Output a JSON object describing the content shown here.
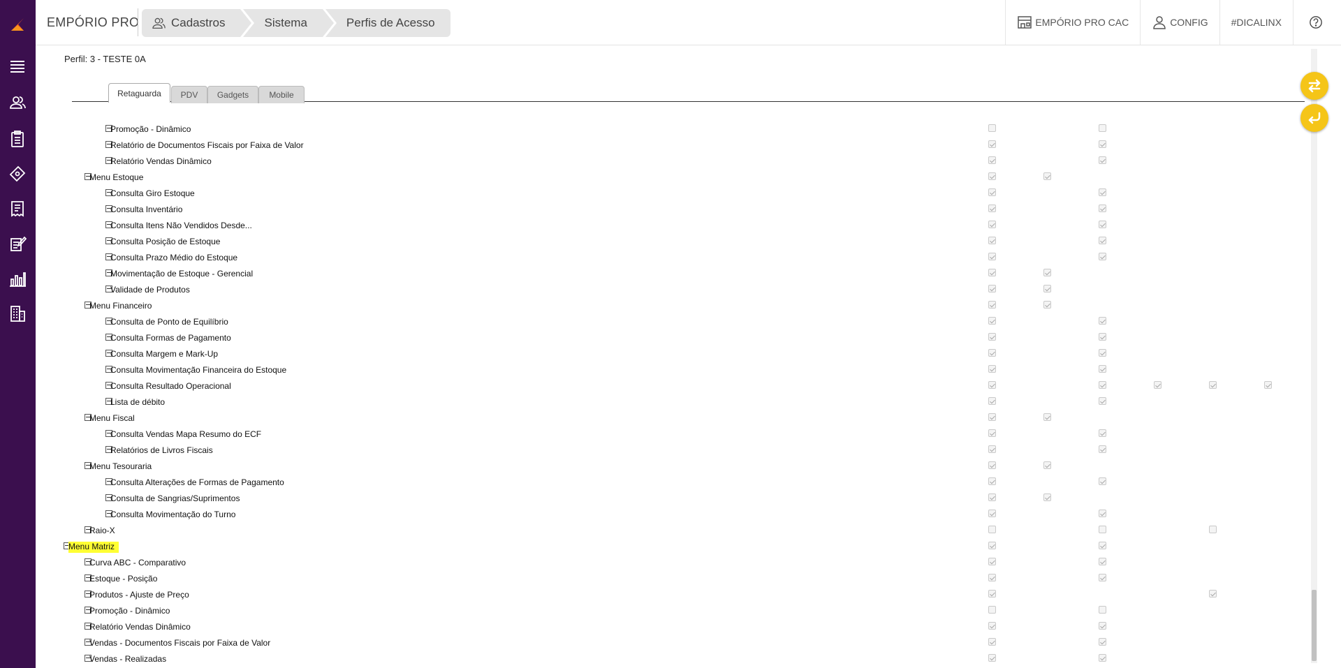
{
  "header": {
    "app_title": "EMPÓRIO PRO",
    "breadcrumb": [
      "Cadastros",
      "Sistema",
      "Perfis de Acesso"
    ],
    "links": [
      "EMPÓRIO PRO CAC",
      "CONFIG",
      "#DICALINX"
    ]
  },
  "profile_label": "Perfil: 3 - TESTE 0A",
  "tabs": [
    "Retaguarda",
    "PDV",
    "Gadgets",
    "Mobile"
  ],
  "active_tab": "Retaguarda",
  "tree_rows": [
    {
      "label": "Promoção - Dinâmico",
      "level": 2,
      "checks": [
        "off",
        "",
        "off",
        "",
        "",
        ""
      ]
    },
    {
      "label": "Relatório de Documentos Fiscais por Faixa de Valor",
      "level": 2,
      "checks": [
        "on",
        "",
        "on",
        "",
        "",
        ""
      ]
    },
    {
      "label": "Relatório Vendas Dinâmico",
      "level": 2,
      "checks": [
        "on",
        "",
        "on",
        "",
        "",
        ""
      ]
    },
    {
      "label": "Menu Estoque",
      "level": 1,
      "checks": [
        "on",
        "on",
        "",
        "",
        "",
        ""
      ]
    },
    {
      "label": "Consulta Giro Estoque",
      "level": 2,
      "checks": [
        "on",
        "",
        "on",
        "",
        "",
        ""
      ]
    },
    {
      "label": "Consulta Inventário",
      "level": 2,
      "checks": [
        "on",
        "",
        "on",
        "",
        "",
        ""
      ]
    },
    {
      "label": "Consulta Itens Não Vendidos Desde...",
      "level": 2,
      "checks": [
        "on",
        "",
        "on",
        "",
        "",
        ""
      ]
    },
    {
      "label": "Consulta Posição de Estoque",
      "level": 2,
      "checks": [
        "on",
        "",
        "on",
        "",
        "",
        ""
      ]
    },
    {
      "label": "Consulta Prazo Médio do Estoque",
      "level": 2,
      "checks": [
        "on",
        "",
        "on",
        "",
        "",
        ""
      ]
    },
    {
      "label": "Movimentação de Estoque - Gerencial",
      "level": 2,
      "checks": [
        "on",
        "on",
        "",
        "",
        "",
        ""
      ]
    },
    {
      "label": "Validade de Produtos",
      "level": 2,
      "checks": [
        "on",
        "on",
        "",
        "",
        "",
        ""
      ]
    },
    {
      "label": "Menu Financeiro",
      "level": 1,
      "checks": [
        "on",
        "on",
        "",
        "",
        "",
        ""
      ]
    },
    {
      "label": "Consulta de Ponto de Equilíbrio",
      "level": 2,
      "checks": [
        "on",
        "",
        "on",
        "",
        "",
        ""
      ]
    },
    {
      "label": "Consulta Formas de Pagamento",
      "level": 2,
      "checks": [
        "on",
        "",
        "on",
        "",
        "",
        ""
      ]
    },
    {
      "label": "Consulta Margem e Mark-Up",
      "level": 2,
      "checks": [
        "on",
        "",
        "on",
        "",
        "",
        ""
      ]
    },
    {
      "label": "Consulta Movimentação Financeira do Estoque",
      "level": 2,
      "checks": [
        "on",
        "",
        "on",
        "",
        "",
        ""
      ]
    },
    {
      "label": "Consulta Resultado Operacional",
      "level": 2,
      "checks": [
        "on",
        "",
        "on",
        "on",
        "on",
        "on"
      ]
    },
    {
      "label": "Lista de débito",
      "level": 2,
      "checks": [
        "on",
        "",
        "on",
        "",
        "",
        ""
      ]
    },
    {
      "label": "Menu Fiscal",
      "level": 1,
      "checks": [
        "on",
        "on",
        "",
        "",
        "",
        ""
      ]
    },
    {
      "label": "Consulta Vendas Mapa Resumo do ECF",
      "level": 2,
      "checks": [
        "on",
        "",
        "on",
        "",
        "",
        ""
      ]
    },
    {
      "label": "Relatórios de Livros Fiscais",
      "level": 2,
      "checks": [
        "on",
        "",
        "on",
        "",
        "",
        ""
      ]
    },
    {
      "label": "Menu Tesouraria",
      "level": 1,
      "checks": [
        "on",
        "on",
        "",
        "",
        "",
        ""
      ]
    },
    {
      "label": "Consulta Alterações de Formas de Pagamento",
      "level": 2,
      "checks": [
        "on",
        "",
        "on",
        "",
        "",
        ""
      ]
    },
    {
      "label": "Consulta de Sangrias/Suprimentos",
      "level": 2,
      "checks": [
        "on",
        "on",
        "",
        "",
        "",
        ""
      ]
    },
    {
      "label": "Consulta Movimentação do Turno",
      "level": 2,
      "checks": [
        "on",
        "",
        "on",
        "",
        "",
        ""
      ]
    },
    {
      "label": "Raio-X",
      "level": 1,
      "checks": [
        "off",
        "",
        "off",
        "",
        "off",
        ""
      ]
    },
    {
      "label": "Menu Matriz",
      "level": 0,
      "highlight": true,
      "checks": [
        "on",
        "",
        "on",
        "",
        "",
        ""
      ]
    },
    {
      "label": "Curva ABC - Comparativo",
      "level": 1,
      "checks": [
        "on",
        "",
        "on",
        "",
        "",
        ""
      ]
    },
    {
      "label": "Estoque - Posição",
      "level": 1,
      "checks": [
        "on",
        "",
        "on",
        "",
        "",
        ""
      ]
    },
    {
      "label": "Produtos - Ajuste de Preço",
      "level": 1,
      "checks": [
        "on",
        "",
        "",
        "",
        "on",
        ""
      ]
    },
    {
      "label": "Promoção - Dinâmico",
      "level": 1,
      "checks": [
        "off",
        "",
        "off",
        "",
        "",
        ""
      ]
    },
    {
      "label": "Relatório Vendas Dinâmico",
      "level": 1,
      "checks": [
        "on",
        "",
        "on",
        "",
        "",
        ""
      ]
    },
    {
      "label": "Vendas - Documentos Fiscais por Faixa de Valor",
      "level": 1,
      "checks": [
        "on",
        "",
        "on",
        "",
        "",
        ""
      ]
    },
    {
      "label": "Vendas - Realizadas",
      "level": 1,
      "checks": [
        "on",
        "",
        "on",
        "",
        "",
        ""
      ]
    }
  ],
  "icons": {
    "sidebar": [
      "menu-icon",
      "users-icon",
      "clipboard-icon",
      "tag-icon",
      "receipt-icon",
      "edit-document-icon",
      "chart-icon",
      "building-icon"
    ],
    "floating": [
      "swap-icon",
      "back-arrow-icon"
    ]
  },
  "colors": {
    "sidebar": "#3b0f4e",
    "accent": "#f5c518",
    "highlight": "#ffff33",
    "logo": "#f15a24"
  }
}
